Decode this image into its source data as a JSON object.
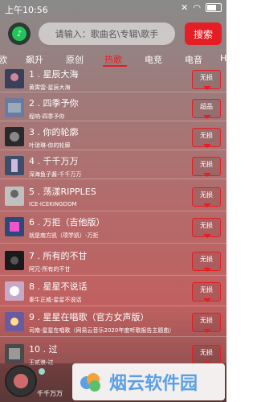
{
  "status_bar": {
    "time": "上午10:56"
  },
  "search": {
    "placeholder": "请输入：歌曲名\\专辑\\歌手",
    "button_label": "搜索"
  },
  "tabs": [
    {
      "label": "欧"
    },
    {
      "label": "飙升"
    },
    {
      "label": "原创"
    },
    {
      "label": "热歌"
    },
    {
      "label": "电竞"
    },
    {
      "label": "电音"
    },
    {
      "label": "H"
    }
  ],
  "active_tab": "热歌",
  "songs": [
    {
      "title": "1 . 星辰大海",
      "subtitle": "黄霄雲-星辰大海",
      "quality": "无损",
      "thumb": "#3a3f5a"
    },
    {
      "title": "2 . 四季予你",
      "subtitle": "程响-四季予你",
      "quality": "超品",
      "thumb": "#6a7aa0"
    },
    {
      "title": "3 . 你的轮廓",
      "subtitle": "叶琼琳-你的轮廓",
      "quality": "无损",
      "thumb": "#2a2a2a"
    },
    {
      "title": "4 . 千千万万",
      "subtitle": "深海鱼子酱-千千万万",
      "quality": "无损",
      "thumb": "#3d4d6a"
    },
    {
      "title": "5 . 荡漾RIPPLES",
      "subtitle": "ICE-ICEKINGDOM",
      "quality": "无损",
      "thumb": "#c0c0c0"
    },
    {
      "title": "6 . 万拒（吉他版）",
      "subtitle": "就是南方凯（项学凯）-万拒",
      "quality": "无损",
      "thumb": "#2a4a7a"
    },
    {
      "title": "7 . 所有的不甘",
      "subtitle": "阿冗-所有的不甘",
      "quality": "无损",
      "thumb": "#1a1a1a"
    },
    {
      "title": "8 . 星星不说话",
      "subtitle": "秦牛正威-星星不说话",
      "quality": "无损",
      "thumb": "#c7a8c7"
    },
    {
      "title": "9 . 星星在唱歌（官方女声版）",
      "subtitle": "司南-星星在唱歌（网易云音乐2020年度听歌报告主题曲）",
      "quality": "无损",
      "thumb": "#6a5aa0"
    },
    {
      "title": "10 . 过",
      "subtitle": "王贰浪-过",
      "quality": "无损",
      "thumb": "#4a4a4a"
    }
  ],
  "player": {
    "title": "千千万万"
  },
  "watermark": {
    "text": "烟云软件园"
  }
}
